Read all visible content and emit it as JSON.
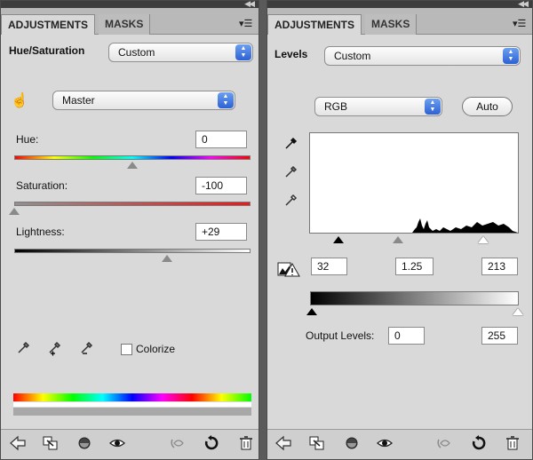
{
  "left_panel": {
    "tabs": [
      "ADJUSTMENTS",
      "MASKS"
    ],
    "title": "Hue/Saturation",
    "preset": "Custom",
    "channel": "Master",
    "hue": {
      "label": "Hue:",
      "value": "0",
      "level": 0.5
    },
    "saturation": {
      "label": "Saturation:",
      "value": "-100",
      "level": 0.0
    },
    "lightness": {
      "label": "Lightness:",
      "value": "+29",
      "level": 0.645
    },
    "colorize_label": "Colorize",
    "colorize_checked": false
  },
  "right_panel": {
    "tabs": [
      "ADJUSTMENTS",
      "MASKS"
    ],
    "title": "Levels",
    "preset": "Custom",
    "channel": "RGB",
    "auto_label": "Auto",
    "input_levels": {
      "black": "32",
      "gamma": "1.25",
      "white": "213"
    },
    "output_label": "Output Levels:",
    "output_levels": {
      "black": "0",
      "white": "255"
    }
  },
  "icons": {
    "bottom_bar": [
      "back-arrow-icon",
      "clip-to-layer-icon",
      "visibility-state-icon",
      "eye-icon",
      "view-previous-icon",
      "reset-icon",
      "trash-icon"
    ],
    "eyedroppers": [
      "eyedropper-icon",
      "eyedropper-plus-icon",
      "eyedropper-minus-icon"
    ]
  },
  "colors": {
    "panel_bg": "#d9d9d9",
    "select_arrow": "#2c61d4"
  }
}
